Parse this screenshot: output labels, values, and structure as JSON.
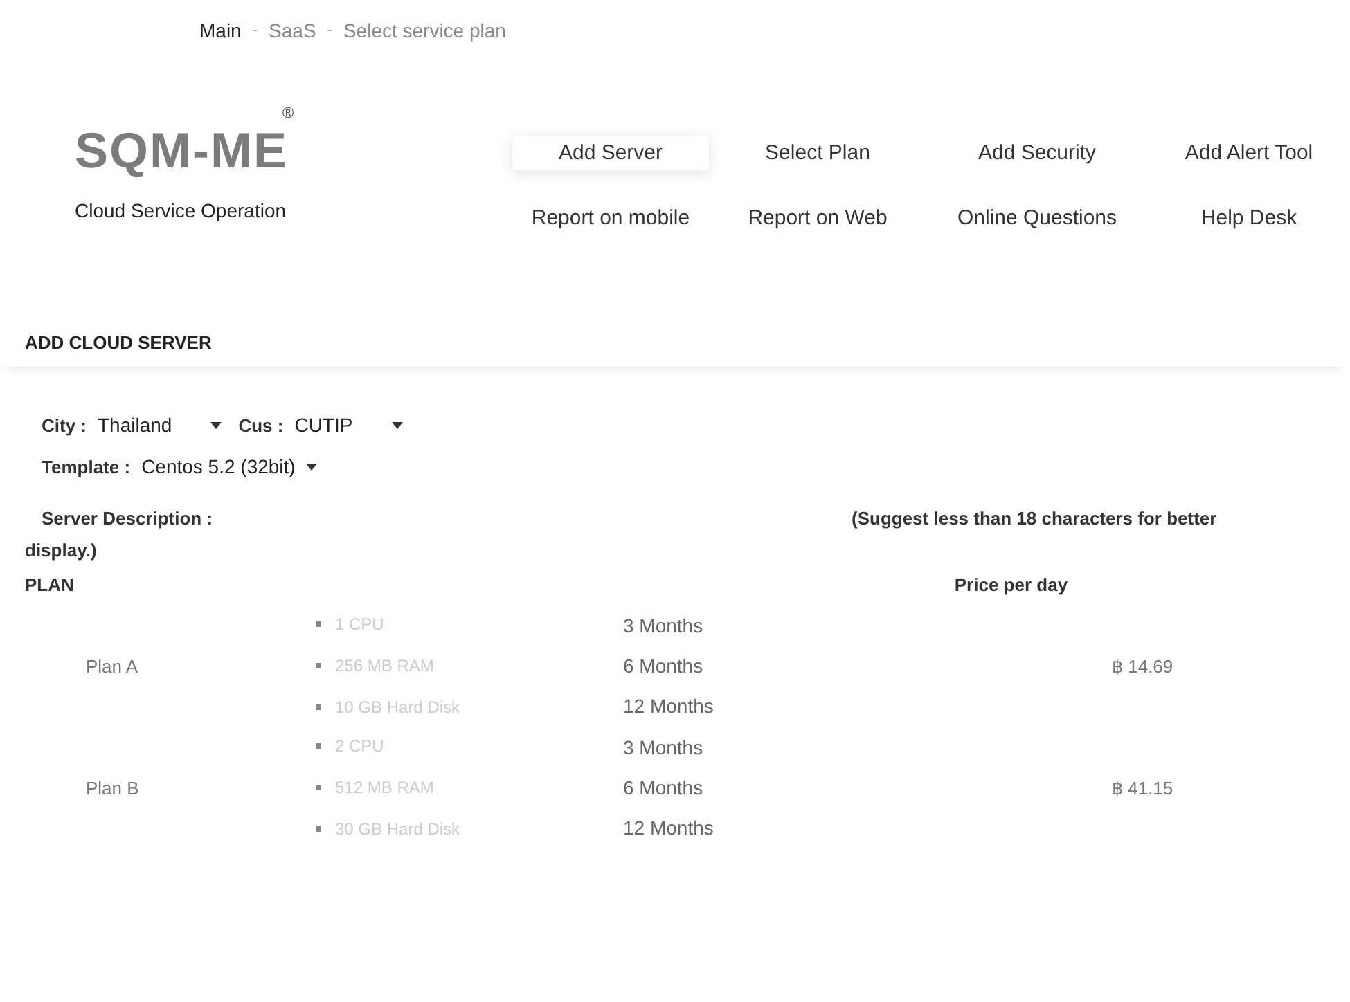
{
  "breadcrumb": [
    {
      "label": "Main",
      "current": false
    },
    {
      "label": "SaaS",
      "current": true
    },
    {
      "label": "Select service plan",
      "current": true
    }
  ],
  "breadcrumb_separator": "-",
  "logo": {
    "name": "SQM-ME",
    "mark": "®",
    "tagline": "Cloud Service Operation"
  },
  "nav": [
    {
      "label": "Add Server",
      "selected": true
    },
    {
      "label": "Select Plan",
      "selected": false
    },
    {
      "label": "Add Security",
      "selected": false
    },
    {
      "label": "Add Alert Tool",
      "selected": false
    },
    {
      "label": "Report on mobile",
      "selected": false
    },
    {
      "label": "Report on Web",
      "selected": false
    },
    {
      "label": "Online Questions",
      "selected": false
    },
    {
      "label": "Help Desk",
      "selected": false
    }
  ],
  "section_title": "ADD CLOUD SERVER",
  "fields_row": [
    {
      "label": "City :",
      "value": "Thailand"
    },
    {
      "label": "Cus :",
      "value": "CUTIP"
    }
  ],
  "template": {
    "label": "Template :",
    "value": "Centos 5.2 (32bit)"
  },
  "description": {
    "label": "Server Description :",
    "hint": "(Suggest less than 18 characters for better",
    "hint_cont": "display.)"
  },
  "plan_header": "PLAN",
  "price_header": "Price per day",
  "plans": [
    {
      "name": "Plan A",
      "features": [
        "1 CPU",
        "256 MB RAM",
        "10 GB Hard Disk"
      ],
      "durations": [
        "3 Months",
        "6 Months",
        "12 Months"
      ],
      "price": "฿ 14.69"
    },
    {
      "name": "Plan B",
      "features": [
        "2 CPU",
        "512 MB RAM",
        "30 GB Hard Disk"
      ],
      "durations": [
        "3 Months",
        "6 Months",
        "12 Months"
      ],
      "price": "฿ 41.15"
    }
  ]
}
